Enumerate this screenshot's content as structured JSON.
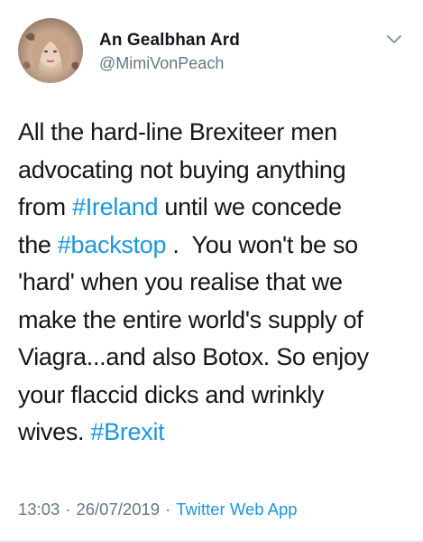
{
  "user": {
    "display_name": "An Gealbhan Ard",
    "handle": "@MimiVonPeach",
    "avatar": "profile-photo"
  },
  "menu_icon": "chevron-down-icon",
  "tweet": {
    "line1": "All the hard-line Brexiteer men",
    "line2": "advocating not buying anything",
    "line3_pre": "from ",
    "line3_tag": "#Ireland",
    "line3_post": " until we concede",
    "line4_pre": "the ",
    "line4_tag": "#backstop",
    "line4_post": " .  You won't be so",
    "line5": "'hard' when you realise that we",
    "line6": "make the entire world's supply of",
    "line7": "Viagra...and also Botox. So enjoy",
    "line8": "your flaccid dicks and wrinkly",
    "line9_pre": "wives. ",
    "line9_tag": "#Brexit"
  },
  "meta": {
    "time": "13:03",
    "separator": "·",
    "date": "26/07/2019",
    "source": "Twitter Web App"
  },
  "colors": {
    "text": "#14171a",
    "secondary": "#657786",
    "link": "#1b95e0"
  }
}
